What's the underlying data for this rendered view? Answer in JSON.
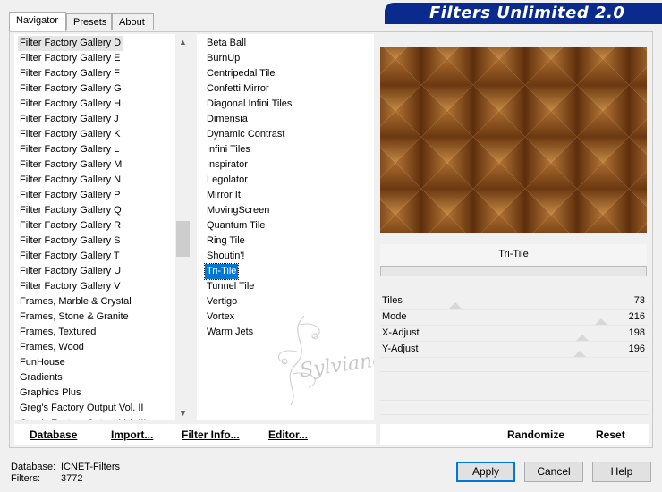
{
  "tabs": [
    {
      "label": "Navigator"
    },
    {
      "label": "Presets"
    },
    {
      "label": "About"
    }
  ],
  "title": "Filters Unlimited 2.0",
  "categories": [
    "Filter Factory Gallery D",
    "Filter Factory Gallery E",
    "Filter Factory Gallery F",
    "Filter Factory Gallery G",
    "Filter Factory Gallery H",
    "Filter Factory Gallery J",
    "Filter Factory Gallery K",
    "Filter Factory Gallery L",
    "Filter Factory Gallery M",
    "Filter Factory Gallery N",
    "Filter Factory Gallery P",
    "Filter Factory Gallery Q",
    "Filter Factory Gallery R",
    "Filter Factory Gallery S",
    "Filter Factory Gallery T",
    "Filter Factory Gallery U",
    "Filter Factory Gallery V",
    "Frames, Marble & Crystal",
    "Frames, Stone & Granite",
    "Frames, Textured",
    "Frames, Wood",
    "FunHouse",
    "Gradients",
    "Graphics Plus",
    "Greg's Factory Output Vol. II",
    "Greg's Factory Output Vol. III"
  ],
  "selected_category": "Filter Factory Gallery D",
  "filters": [
    "Beta Ball",
    "BurnUp",
    "Centripedal Tile",
    "Confetti Mirror",
    "Diagonal Infini Tiles",
    "Dimensia",
    "Dynamic Contrast",
    "Infini Tiles",
    "Inspirator",
    "Legolator",
    "Mirror It",
    "MovingScreen",
    "Quantum Tile",
    "Ring Tile",
    "Shoutin'!",
    "Tri-Tile",
    "Tunnel Tile",
    "Vertigo",
    "Vortex",
    "Warm Jets"
  ],
  "selected_filter": "Tri-Tile",
  "watermark_text": "Sylviane",
  "filter_name": "Tri-Tile",
  "params": [
    {
      "label": "Tiles",
      "value": "73",
      "level": 0.29
    },
    {
      "label": "Mode",
      "value": "216",
      "level": 0.85
    },
    {
      "label": "X-Adjust",
      "value": "198",
      "level": 0.78
    },
    {
      "label": "Y-Adjust",
      "value": "196",
      "level": 0.77
    }
  ],
  "buttons": {
    "database": "Database",
    "import": "Import...",
    "filter_info": "Filter Info...",
    "editor": "Editor...",
    "randomize": "Randomize",
    "reset": "Reset",
    "apply": "Apply",
    "cancel": "Cancel",
    "help": "Help"
  },
  "status": {
    "database_label": "Database:",
    "database_value": "ICNET-Filters",
    "filters_label": "Filters:",
    "filters_value": "3772"
  },
  "colors": {
    "title_bg": "#0a2a8e",
    "selection": "#0078d7",
    "preview_dark": "#6e3a12",
    "preview_light": "#b57a3a"
  }
}
